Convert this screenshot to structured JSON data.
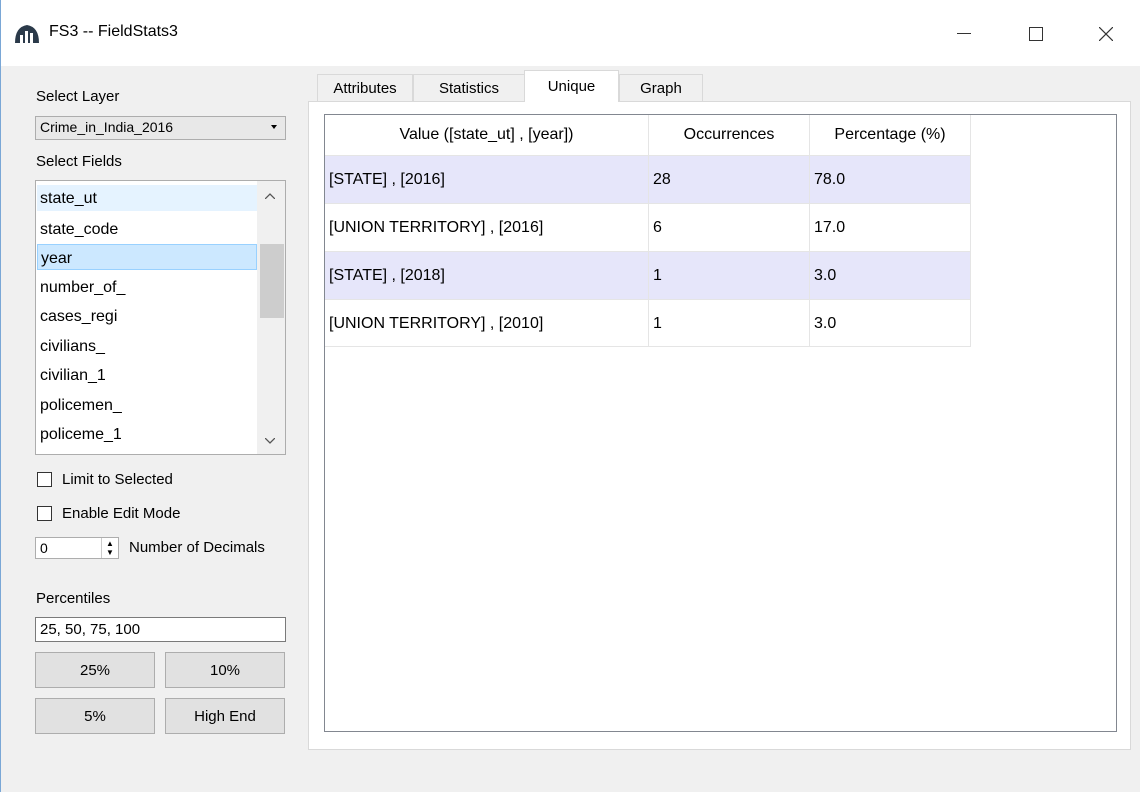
{
  "window": {
    "title": "FS3 -- FieldStats3"
  },
  "left_panel": {
    "select_layer_label": "Select Layer",
    "layer_value": "Crime_in_India_2016",
    "select_fields_label": "Select Fields",
    "fields": [
      "state_ut",
      "state_code",
      "year",
      "number_of_",
      "cases_regi",
      "civilians_",
      "civilian_1",
      "policemen_",
      "policeme_1"
    ],
    "limit_to_selected_label": "Limit to Selected",
    "enable_edit_mode_label": "Enable Edit Mode",
    "decimals_value": "0",
    "decimals_label": "Number of Decimals",
    "percentiles_label": "Percentiles",
    "percentiles_value": "25, 50, 75, 100",
    "buttons": {
      "p25": "25%",
      "p10": "10%",
      "p5": "5%",
      "high_end": "High End"
    }
  },
  "tabs": [
    "Attributes",
    "Statistics",
    "Unique",
    "Graph"
  ],
  "active_tab": "Unique",
  "table": {
    "headers": [
      "Value ([state_ut] , [year])",
      "Occurrences",
      "Percentage (%)"
    ],
    "rows": [
      [
        "[STATE] , [2016]",
        "28",
        "78.0"
      ],
      [
        "[UNION TERRITORY] , [2016]",
        "6",
        "17.0"
      ],
      [
        "[STATE] , [2018]",
        "1",
        "3.0"
      ],
      [
        "[UNION TERRITORY] , [2010]",
        "1",
        "3.0"
      ]
    ]
  },
  "colors": {
    "selection": "#cce8ff",
    "alt_row": "#e6e6fa",
    "window_border": "#7aa7d6"
  }
}
